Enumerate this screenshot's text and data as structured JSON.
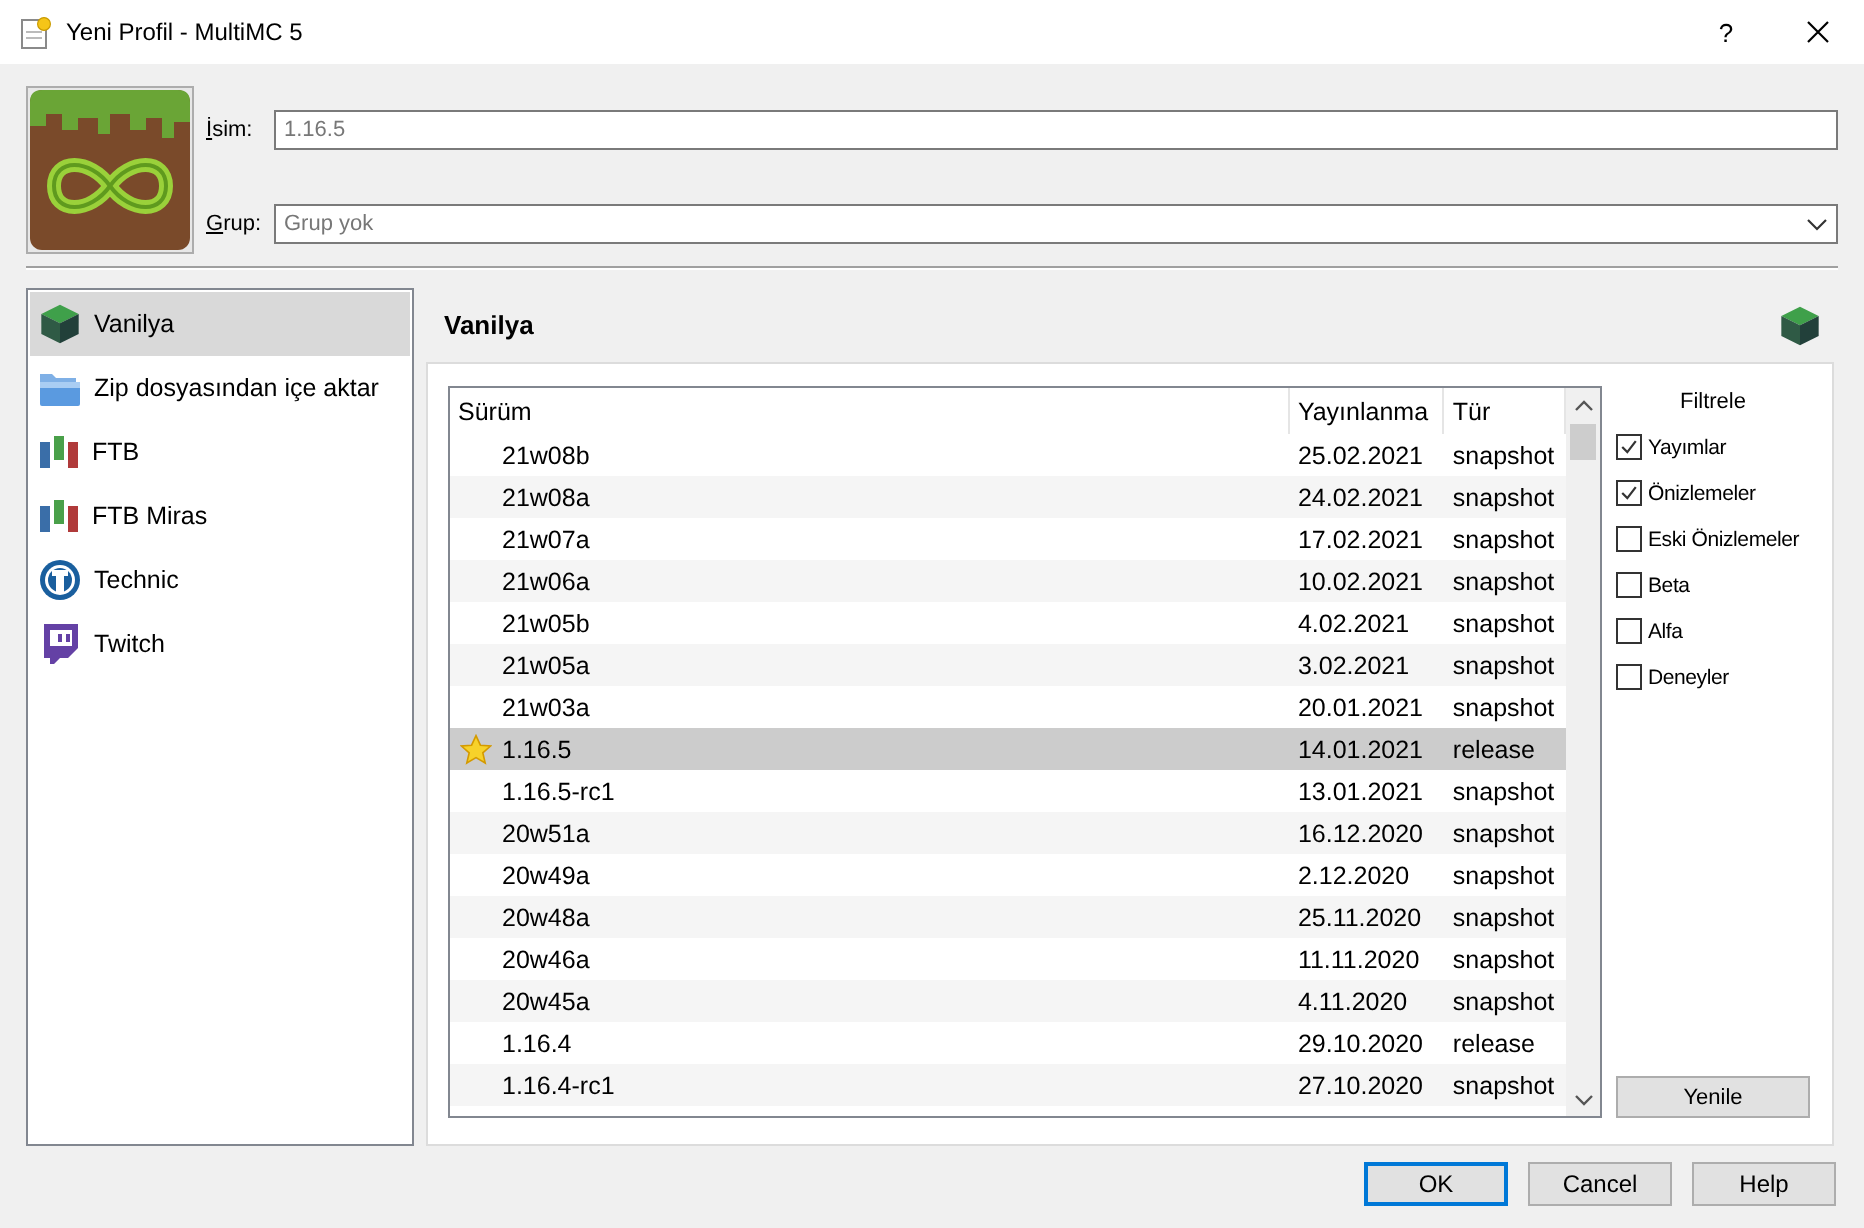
{
  "window": {
    "title": "Yeni Profil - MultiMC 5",
    "help_button": "?"
  },
  "profile": {
    "name_label": "İsim:",
    "name_placeholder": "1.16.5",
    "group_label": "Grup:",
    "group_placeholder": "Grup yok"
  },
  "sources": [
    {
      "label": "Vanilya",
      "kind": "vanilla",
      "selected": true
    },
    {
      "label": "Zip dosyasından içe aktar",
      "kind": "zip",
      "selected": false
    },
    {
      "label": "FTB",
      "kind": "ftb",
      "selected": false
    },
    {
      "label": "FTB Miras",
      "kind": "ftb",
      "selected": false
    },
    {
      "label": "Technic",
      "kind": "technic",
      "selected": false
    },
    {
      "label": "Twitch",
      "kind": "twitch",
      "selected": false
    }
  ],
  "panel": {
    "title": "Vanilya"
  },
  "versions": {
    "columns": [
      "Sürüm",
      "Yayınlanma",
      "Tür"
    ],
    "rows": [
      {
        "version": "21w08b",
        "released": "25.02.2021",
        "type": "snapshot",
        "selected": false,
        "recommended": false
      },
      {
        "version": "21w08a",
        "released": "24.02.2021",
        "type": "snapshot",
        "selected": false,
        "recommended": false
      },
      {
        "version": "21w07a",
        "released": "17.02.2021",
        "type": "snapshot",
        "selected": false,
        "recommended": false
      },
      {
        "version": "21w06a",
        "released": "10.02.2021",
        "type": "snapshot",
        "selected": false,
        "recommended": false
      },
      {
        "version": "21w05b",
        "released": "4.02.2021",
        "type": "snapshot",
        "selected": false,
        "recommended": false
      },
      {
        "version": "21w05a",
        "released": "3.02.2021",
        "type": "snapshot",
        "selected": false,
        "recommended": false
      },
      {
        "version": "21w03a",
        "released": "20.01.2021",
        "type": "snapshot",
        "selected": false,
        "recommended": false
      },
      {
        "version": "1.16.5",
        "released": "14.01.2021",
        "type": "release",
        "selected": true,
        "recommended": true
      },
      {
        "version": "1.16.5-rc1",
        "released": "13.01.2021",
        "type": "snapshot",
        "selected": false,
        "recommended": false
      },
      {
        "version": "20w51a",
        "released": "16.12.2020",
        "type": "snapshot",
        "selected": false,
        "recommended": false
      },
      {
        "version": "20w49a",
        "released": "2.12.2020",
        "type": "snapshot",
        "selected": false,
        "recommended": false
      },
      {
        "version": "20w48a",
        "released": "25.11.2020",
        "type": "snapshot",
        "selected": false,
        "recommended": false
      },
      {
        "version": "20w46a",
        "released": "11.11.2020",
        "type": "snapshot",
        "selected": false,
        "recommended": false
      },
      {
        "version": "20w45a",
        "released": "4.11.2020",
        "type": "snapshot",
        "selected": false,
        "recommended": false
      },
      {
        "version": "1.16.4",
        "released": "29.10.2020",
        "type": "release",
        "selected": false,
        "recommended": false
      },
      {
        "version": "1.16.4-rc1",
        "released": "27.10.2020",
        "type": "snapshot",
        "selected": false,
        "recommended": false
      }
    ]
  },
  "filters": {
    "title": "Filtrele",
    "items": [
      {
        "label": "Yayımlar",
        "checked": true
      },
      {
        "label": "Önizlemeler",
        "checked": true
      },
      {
        "label": "Eski Önizlemeler",
        "checked": false
      },
      {
        "label": "Beta",
        "checked": false
      },
      {
        "label": "Alfa",
        "checked": false
      },
      {
        "label": "Deneyler",
        "checked": false
      }
    ],
    "refresh_button": "Yenile"
  },
  "buttons": [
    {
      "label": "OK",
      "default": true
    },
    {
      "label": "Cancel",
      "default": false
    },
    {
      "label": "Help",
      "default": false
    }
  ]
}
